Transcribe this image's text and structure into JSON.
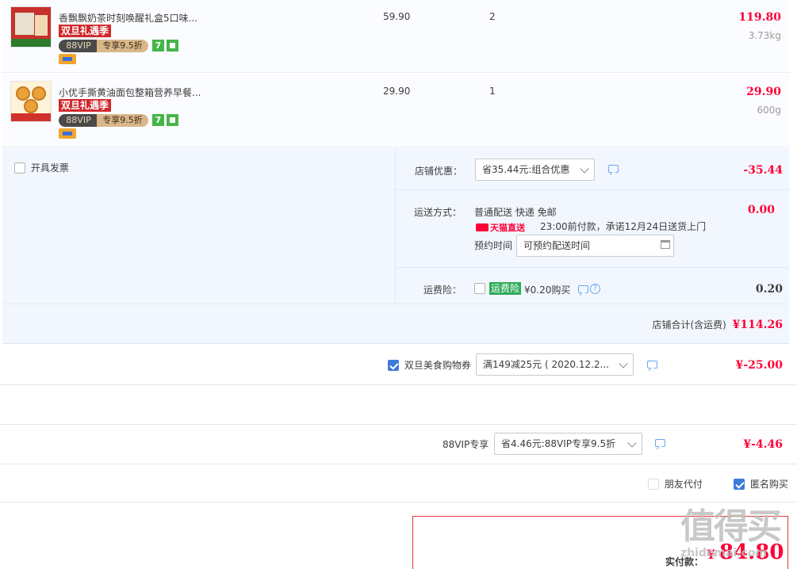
{
  "items": [
    {
      "name": "香飘飘奶茶时刻唤醒礼盒5口味...",
      "promo_tag": "双旦礼遇季",
      "vip_left": "88VIP",
      "vip_right": "专享9.5折",
      "seven_icon": "7",
      "unit_price": "59.90",
      "qty": "2",
      "total": "119.80",
      "weight": "3.73kg"
    },
    {
      "name": "小优手撕黄油面包整箱营养早餐...",
      "promo_tag": "双旦礼遇季",
      "vip_left": "88VIP",
      "vip_right": "专享9.5折",
      "seven_icon": "7",
      "unit_price": "29.90",
      "qty": "1",
      "total": "29.90",
      "weight": "600g"
    }
  ],
  "invoice": {
    "label": "开具发票"
  },
  "shop_discount": {
    "label": "店铺优惠：",
    "select_value": "省35.44元:组合优惠",
    "amount": "-35.44"
  },
  "shipping": {
    "label": "运送方式：",
    "method": "普通配送 快递 免邮",
    "tmall_text": "天猫直送",
    "promise": "23:00前付款，承诺12月24日送货上门",
    "schedule_label": "预约时间",
    "schedule_placeholder": "可预约配送时间",
    "amount": "0.00"
  },
  "insurance": {
    "label": "运费险：",
    "badge": "运费险",
    "price_text": "¥0.20购买",
    "amount": "0.20"
  },
  "shop_total": {
    "label": "店铺合计(含运费)",
    "amount": "¥114.26"
  },
  "coupon": {
    "label": "双旦美食购物券",
    "select_value": "满149减25元 ( 2020.12.2...",
    "amount": "¥-25.00"
  },
  "vip_discount": {
    "label": "88VIP专享",
    "select_value": "省4.46元:88VIP专享9.5折",
    "amount": "¥-4.46"
  },
  "options": {
    "friend_pay": "朋友代付",
    "anonymous": "匿名购买"
  },
  "pay": {
    "label": "实付款：",
    "currency": "¥",
    "amount": "84.80"
  },
  "watermark": {
    "text": "值得买",
    "url": "zhidemai.com"
  },
  "colors": {
    "price_red": "#ff0036",
    "checkbox_blue": "#3d7bdb",
    "promo_red": "#d1282c",
    "shop_bg": "#f2f7ff"
  }
}
